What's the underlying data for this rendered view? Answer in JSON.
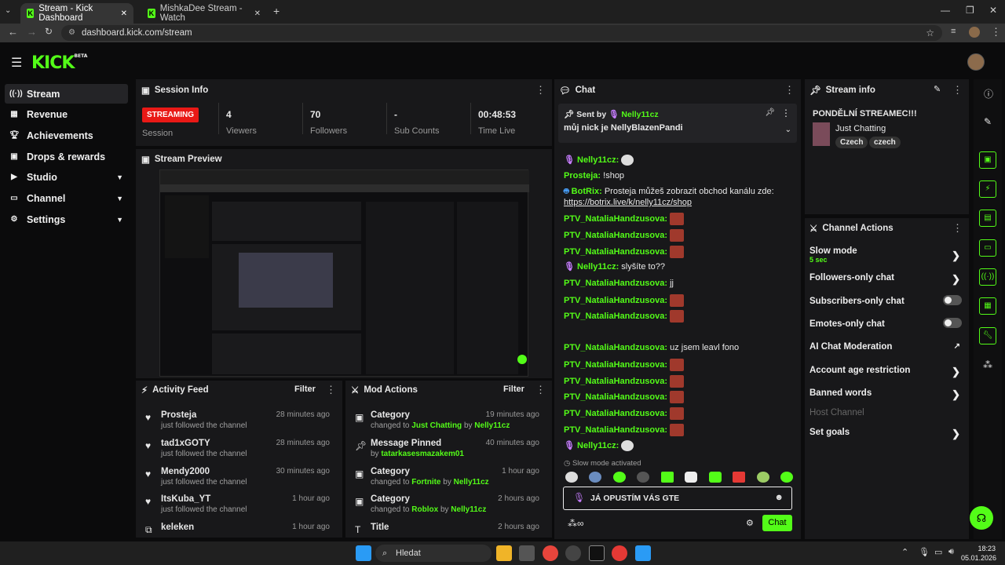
{
  "browser": {
    "tabs": [
      {
        "title": "Stream - Kick Dashboard"
      },
      {
        "title": "MishkaDee Stream - Watch"
      }
    ],
    "url": "dashboard.kick.com/stream"
  },
  "app": {
    "logo": "KICK",
    "beta": "BETA"
  },
  "sidebar": {
    "items": [
      {
        "label": "Stream",
        "icon": "stream-icon"
      },
      {
        "label": "Revenue",
        "icon": "revenue-icon"
      },
      {
        "label": "Achievements",
        "icon": "trophy-icon"
      },
      {
        "label": "Drops & rewards",
        "icon": "gift-icon"
      },
      {
        "label": "Studio",
        "icon": "video-icon"
      },
      {
        "label": "Channel",
        "icon": "channel-icon"
      },
      {
        "label": "Settings",
        "icon": "gear-icon"
      }
    ]
  },
  "session": {
    "title": "Session Info",
    "status": "STREAMING",
    "status_label": "Session",
    "stats": [
      {
        "value": "4",
        "label": "Viewers"
      },
      {
        "value": "70",
        "label": "Followers"
      },
      {
        "value": "-",
        "label": "Sub Counts"
      },
      {
        "value": "00:48:53",
        "label": "Time Live"
      }
    ]
  },
  "preview": {
    "title": "Stream Preview"
  },
  "activity": {
    "title": "Activity Feed",
    "filter": "Filter",
    "items": [
      {
        "name": "Prosteja",
        "sub": "just followed the channel",
        "time": "28 minutes ago"
      },
      {
        "name": "tad1xGOTY",
        "sub": "just followed the channel",
        "time": "28 minutes ago"
      },
      {
        "name": "Mendy2000",
        "sub": "just followed the channel",
        "time": "30 minutes ago"
      },
      {
        "name": "ItsKuba_YT",
        "sub": "just followed the channel",
        "time": "1 hour ago"
      },
      {
        "name": "keleken",
        "sub": "",
        "time": "1 hour ago"
      }
    ]
  },
  "mod": {
    "title": "Mod Actions",
    "filter": "Filter",
    "items": [
      {
        "name": "Category",
        "pre": "changed to",
        "target": "Just Chatting",
        "by": "by",
        "user": "Nelly11cz",
        "time": "19 minutes ago"
      },
      {
        "name": "Message Pinned",
        "pre": "by",
        "target": "tatarkasesmazakem01",
        "by": "",
        "user": "",
        "time": "40 minutes ago"
      },
      {
        "name": "Category",
        "pre": "changed to",
        "target": "Fortnite",
        "by": "by",
        "user": "Nelly11cz",
        "time": "1 hour ago"
      },
      {
        "name": "Category",
        "pre": "changed to",
        "target": "Roblox",
        "by": "by",
        "user": "Nelly11cz",
        "time": "2 hours ago"
      },
      {
        "name": "Title",
        "pre": "",
        "target": "",
        "by": "",
        "user": "",
        "time": "2 hours ago"
      }
    ]
  },
  "chat": {
    "title": "Chat",
    "pinned": {
      "sent_by": "Sent by",
      "user": "Nelly11cz",
      "message": "můj nick je NellyBlazenPandi"
    },
    "lines": [
      {
        "user": "Nelly11cz:",
        "text": "",
        "emotes": 1
      },
      {
        "user": "Prosteja:",
        "text": "!shop",
        "emotes": 0
      },
      {
        "user": "BotRix:",
        "text": "Prosteja můžeš zobrazit obchod kanálu zde:",
        "link": "https://botrix.live/k/nelly11cz/shop",
        "emotes": 0
      },
      {
        "user": "PTV_NataliaHandzusova:",
        "text": "",
        "emotes": 1
      },
      {
        "user": "PTV_NataliaHandzusova:",
        "text": "",
        "emotes": 1
      },
      {
        "user": "PTV_NataliaHandzusova:",
        "text": "",
        "emotes": 1
      },
      {
        "user": "Nelly11cz:",
        "text": "slyšíte to??",
        "emotes": 0
      },
      {
        "user": "PTV_NataliaHandzusova:",
        "text": "jj",
        "emotes": 0
      },
      {
        "user": "PTV_NataliaHandzusova:",
        "text": "",
        "emotes": 1
      },
      {
        "user": "PTV_NataliaHandzusova:",
        "text": "",
        "emotes": 1
      },
      {
        "user": "PTV_NataliaHandzusova:",
        "text": "uz jsem leavl fono",
        "emotes": 0
      },
      {
        "user": "PTV_NataliaHandzusova:",
        "text": "",
        "emotes": 1
      },
      {
        "user": "PTV_NataliaHandzusova:",
        "text": "",
        "emotes": 1
      },
      {
        "user": "PTV_NataliaHandzusova:",
        "text": "",
        "emotes": 1
      },
      {
        "user": "PTV_NataliaHandzusova:",
        "text": "",
        "emotes": 1
      },
      {
        "user": "PTV_NataliaHandzusova:",
        "text": "",
        "emotes": 1
      },
      {
        "user": "Nelly11cz:",
        "text": "",
        "emotes": 1
      }
    ],
    "slow_mode_notice": "Slow mode activated",
    "input_value": "JÁ OPUSTÍM VÁS GTE",
    "send_label": "Chat"
  },
  "stream_info": {
    "title": "Stream info",
    "stream_title": "PONDĚLNÍ STREAMEC!!!",
    "category": "Just Chatting",
    "tags": [
      "Czech",
      "czech"
    ]
  },
  "channel_actions": {
    "title": "Channel Actions",
    "items": [
      {
        "label": "Slow mode",
        "sub": "5 sec",
        "control": "arrow"
      },
      {
        "label": "Followers-only chat",
        "sub": "",
        "control": "arrow"
      },
      {
        "label": "Subscribers-only chat",
        "sub": "",
        "control": "toggle"
      },
      {
        "label": "Emotes-only chat",
        "sub": "",
        "control": "toggle"
      },
      {
        "label": "AI Chat Moderation",
        "sub": "",
        "control": "external"
      },
      {
        "label": "Account age restriction",
        "sub": "",
        "control": "arrow"
      },
      {
        "label": "Banned words",
        "sub": "",
        "control": "arrow"
      },
      {
        "label": "Host Channel",
        "sub": "",
        "control": "none"
      },
      {
        "label": "Set goals",
        "sub": "",
        "control": "arrow"
      }
    ]
  },
  "taskbar": {
    "search": "Hledat",
    "time": "18:23",
    "date": "05.01.2026"
  },
  "colors": {
    "accent": "#53fc18",
    "live": "#e91916",
    "panel": "#18181a"
  }
}
